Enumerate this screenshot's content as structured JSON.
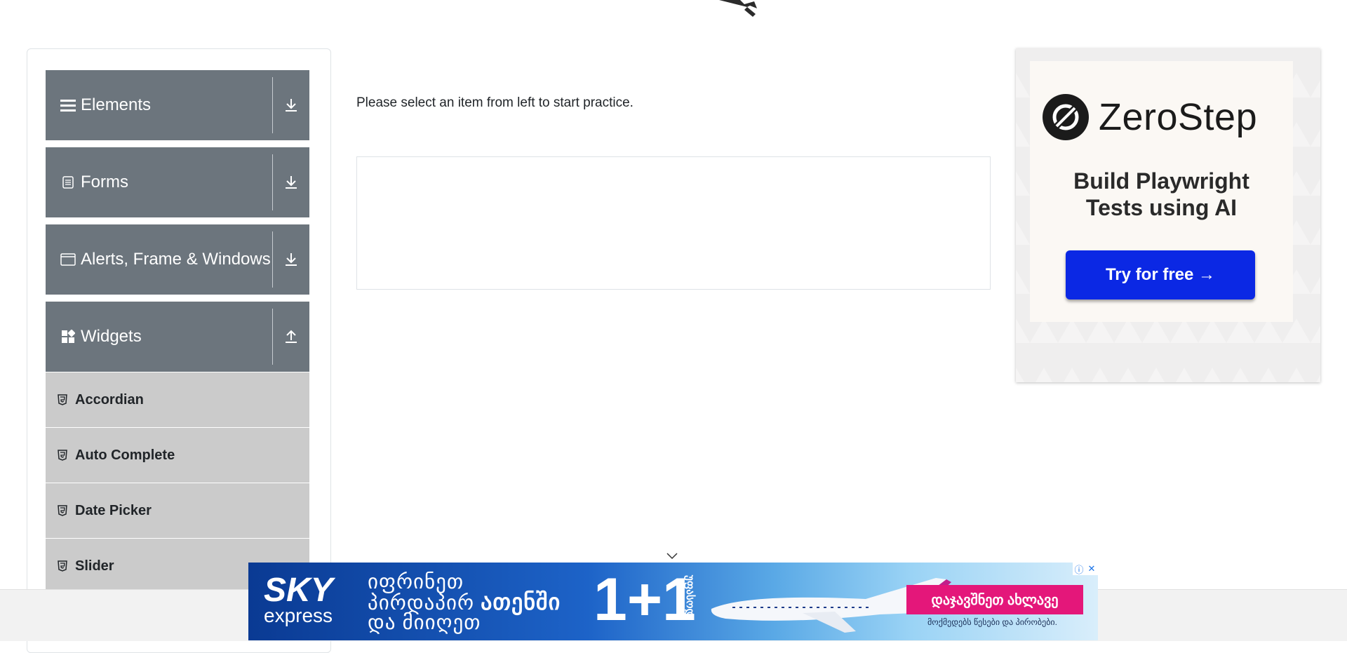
{
  "sidebar": {
    "groups": [
      {
        "label": "Elements",
        "icon": "hamburger-icon",
        "arrow": "download-arrow-icon"
      },
      {
        "label": "Forms",
        "icon": "document-icon",
        "arrow": "download-arrow-icon"
      },
      {
        "label": "Alerts, Frame & Windows",
        "icon": "window-icon",
        "arrow": "download-arrow-icon"
      },
      {
        "label": "Widgets",
        "icon": "grid-icon",
        "arrow": "upload-arrow-icon"
      }
    ],
    "widget_items": [
      {
        "label": "Accordian",
        "icon": "html5-icon"
      },
      {
        "label": "Auto Complete",
        "icon": "html5-icon"
      },
      {
        "label": "Date Picker",
        "icon": "html5-icon"
      },
      {
        "label": "Slider",
        "icon": "html5-icon"
      }
    ]
  },
  "main": {
    "instruction": "Please select an item from left to start practice."
  },
  "right_ad": {
    "brand": "ZeroStep",
    "headline_line1": "Build Playwright",
    "headline_line2": "Tests using AI",
    "cta": "Try for free →"
  },
  "bottom_ad": {
    "logo_big": "SKY",
    "logo_small": "express",
    "line1": "იფრინეთ",
    "line2_prefix": "პირდაპირ",
    "line2_bold": "ათენში",
    "line3": "და მიიღეთ",
    "offer": "1+1",
    "offer_side": "უფასოდ",
    "cta": "დაჯავშნეთ ახლავე",
    "note": "მოქმედებს წესები და პირობები.",
    "info_icon": "ⓘ",
    "close_icon": "✕"
  },
  "colors": {
    "group_bg": "#6c757d",
    "item_bg": "#cbcbcb",
    "zs_button": "#0b28e4",
    "ad_cta": "#e4177a"
  }
}
